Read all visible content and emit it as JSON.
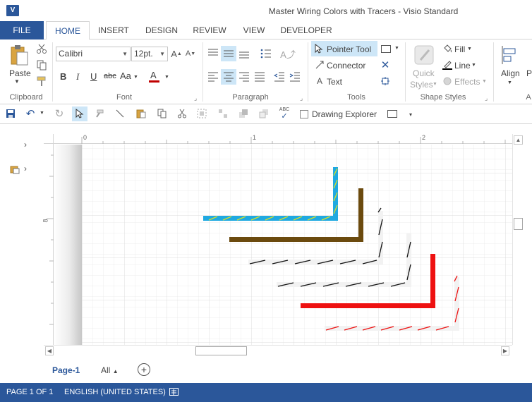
{
  "window": {
    "app_icon": "V",
    "title": "Master Wiring Colors with Tracers - Visio Standard"
  },
  "tabs": {
    "file": "FILE",
    "items": [
      "HOME",
      "INSERT",
      "DESIGN",
      "REVIEW",
      "VIEW",
      "DEVELOPER"
    ],
    "active": "HOME"
  },
  "ribbon": {
    "clipboard": {
      "label": "Clipboard",
      "paste": "Paste"
    },
    "font": {
      "label": "Font",
      "family": "Calibri",
      "size": "12pt.",
      "bold": "B",
      "italic": "I",
      "underline": "U",
      "strike": "abc",
      "case": "Aa",
      "color_letter": "A",
      "font_color": "#c00000"
    },
    "paragraph": {
      "label": "Paragraph"
    },
    "tools": {
      "label": "Tools",
      "pointer": "Pointer Tool",
      "connector": "Connector",
      "text": "Text"
    },
    "shape_styles": {
      "label": "Shape Styles",
      "quick_styles_1": "Quick",
      "quick_styles_2": "Styles",
      "fill": "Fill",
      "line": "Line",
      "effects": "Effects"
    },
    "arrange": {
      "align": "Align",
      "position": "P",
      "group_label": "A"
    }
  },
  "qat": {
    "drawing_explorer": "Drawing Explorer",
    "spelling": "ABC"
  },
  "rulers": {
    "h_labels": [
      "0",
      "1",
      "2"
    ],
    "v_label": "8"
  },
  "pages": {
    "current": "Page-1",
    "all": "All"
  },
  "status": {
    "page": "PAGE 1 OF 1",
    "language": "ENGLISH (UNITED STATES)"
  },
  "colors": {
    "accent": "#2b579a",
    "wire_cyan": "#1fa9e1",
    "wire_tracer_yellow": "#d9e021",
    "wire_brown": "#6b4a0e",
    "wire_red": "#ee1111",
    "tracer_black": "#111111",
    "tracer_red": "#ee1111"
  }
}
